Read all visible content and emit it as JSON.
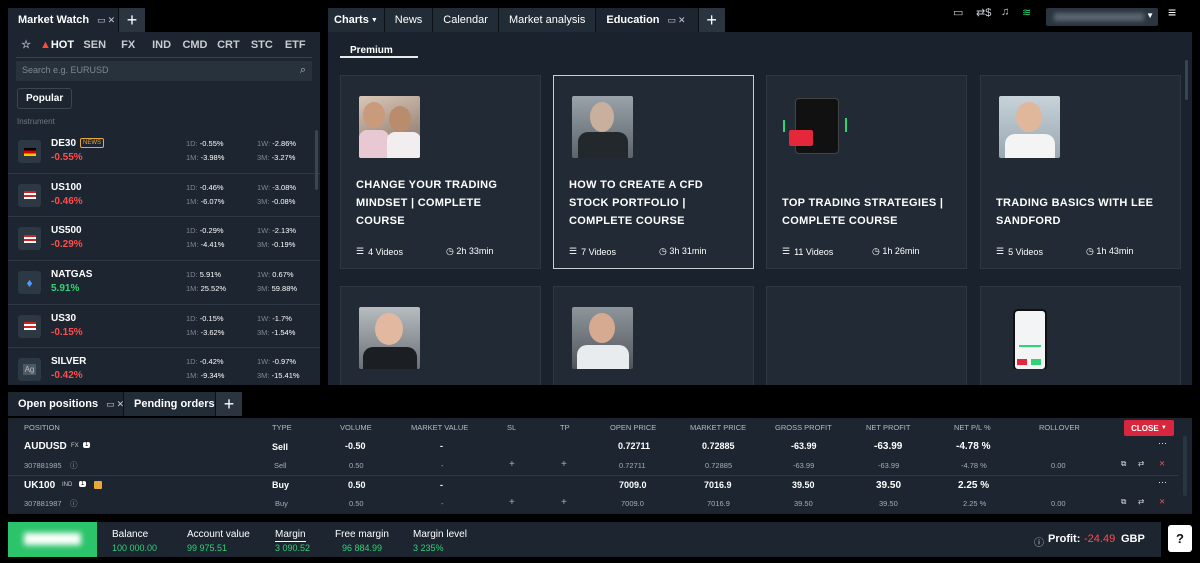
{
  "market_watch": {
    "tab_label": "Market Watch",
    "categories": [
      "HOT",
      "SEN",
      "FX",
      "IND",
      "CMD",
      "CRT",
      "STC",
      "ETF"
    ],
    "search_placeholder": "Search e.g. EURUSD",
    "popular_label": "Popular",
    "instrument_header": "Instrument",
    "items": [
      {
        "symbol": "DE30",
        "change": "-0.55%",
        "badge": "NEWS",
        "d1": "-0.55%",
        "w1": "-2.86%",
        "m1": "-3.98%",
        "m3": "-3.27%",
        "dir": "neg",
        "flag": "de"
      },
      {
        "symbol": "US100",
        "change": "-0.46%",
        "d1": "-0.46%",
        "w1": "-3.08%",
        "m1": "-6.07%",
        "m3": "-0.08%",
        "dir": "neg",
        "flag": "us"
      },
      {
        "symbol": "US500",
        "change": "-0.29%",
        "d1": "-0.29%",
        "w1": "-2.13%",
        "m1": "-4.41%",
        "m3": "-0.19%",
        "dir": "neg",
        "flag": "us"
      },
      {
        "symbol": "NATGAS",
        "change": "5.91%",
        "d1": "5.91%",
        "w1": "0.67%",
        "m1": "25.52%",
        "m3": "59.88%",
        "dir": "pos",
        "flag": "gas"
      },
      {
        "symbol": "US30",
        "change": "-0.15%",
        "d1": "-0.15%",
        "w1": "-1.7%",
        "m1": "-3.62%",
        "m3": "-1.54%",
        "dir": "neg",
        "flag": "us"
      },
      {
        "symbol": "SILVER",
        "change": "-0.42%",
        "d1": "-0.42%",
        "w1": "-0.97%",
        "m1": "-9.34%",
        "m3": "-15.41%",
        "dir": "neg",
        "flag": "ag"
      }
    ],
    "period_labels": {
      "d1": "1D:",
      "w1": "1W:",
      "m1": "1M:",
      "m3": "3M:"
    }
  },
  "top_tabs": [
    "Charts",
    "News",
    "Calendar",
    "Market analysis",
    "Education"
  ],
  "education": {
    "subtab": "Premium",
    "courses": [
      {
        "title": "CHANGE YOUR TRADING MINDSET | COMPLETE COURSE",
        "videos": "4 Videos",
        "duration": "2h 33min"
      },
      {
        "title": "HOW TO CREATE A CFD STOCK PORTFOLIO | COMPLETE COURSE",
        "videos": "7 Videos",
        "duration": "3h 31min"
      },
      {
        "title": "TOP TRADING STRATEGIES | COMPLETE COURSE",
        "videos": "11 Videos",
        "duration": "1h 26min"
      },
      {
        "title": "TRADING BASICS WITH LEE SANDFORD",
        "videos": "5 Videos",
        "duration": "1h 43min"
      }
    ]
  },
  "bottom_tabs": [
    "Open positions",
    "Pending orders"
  ],
  "positions": {
    "headers": [
      "POSITION",
      "TYPE",
      "VOLUME",
      "MARKET VALUE",
      "SL",
      "TP",
      "OPEN PRICE",
      "MARKET PRICE",
      "GROSS PROFIT",
      "NET PROFIT",
      "NET P/L %",
      "ROLLOVER"
    ],
    "close_label": "CLOSE",
    "rows": [
      {
        "symbol": "AUDUSD",
        "tag": "FX",
        "count": "1",
        "type": "Sell",
        "volume": "-0.50",
        "market_value": "-",
        "open": "0.72711",
        "market": "0.72885",
        "gross": "-63.99",
        "net": "-63.99",
        "netpct": "-4.78 %",
        "id": "307881985",
        "sub_type": "Sell",
        "sub_volume": "0.50",
        "sub_mv": "-",
        "sub_sl": "+",
        "sub_tp": "+",
        "sub_open": "0.72711",
        "sub_market": "0.72885",
        "sub_gross": "-63.99",
        "sub_net": "-63.99",
        "sub_netpct": "-4.78 %",
        "rollover": "0.00",
        "dir": "neg"
      },
      {
        "symbol": "UK100",
        "tag": "IND",
        "count": "1",
        "type": "Buy",
        "volume": "0.50",
        "market_value": "-",
        "open": "7009.0",
        "market": "7016.9",
        "gross": "39.50",
        "net": "39.50",
        "netpct": "2.25 %",
        "id": "307881987",
        "sub_type": "Buy",
        "sub_volume": "0.50",
        "sub_mv": "-",
        "sub_sl": "+",
        "sub_tp": "+",
        "sub_open": "7009.0",
        "sub_market": "7016.9",
        "sub_gross": "39.50",
        "sub_net": "39.50",
        "sub_netpct": "2.25 %",
        "rollover": "0.00",
        "dir": "pos"
      }
    ]
  },
  "account": {
    "balance_label": "Balance",
    "balance": "100 000.00",
    "account_value_label": "Account value",
    "account_value": "99 975.51",
    "margin_label": "Margin",
    "margin": "3 090.52",
    "free_margin_label": "Free margin",
    "free_margin": "96 884.99",
    "margin_level_label": "Margin level",
    "margin_level": "3 235%",
    "profit_label": "Profit:",
    "profit": "-24.49",
    "currency": "GBP"
  },
  "colors": {
    "accent_green": "#2ed573",
    "accent_red": "#ff4d4d",
    "panel": "#1c2530"
  }
}
